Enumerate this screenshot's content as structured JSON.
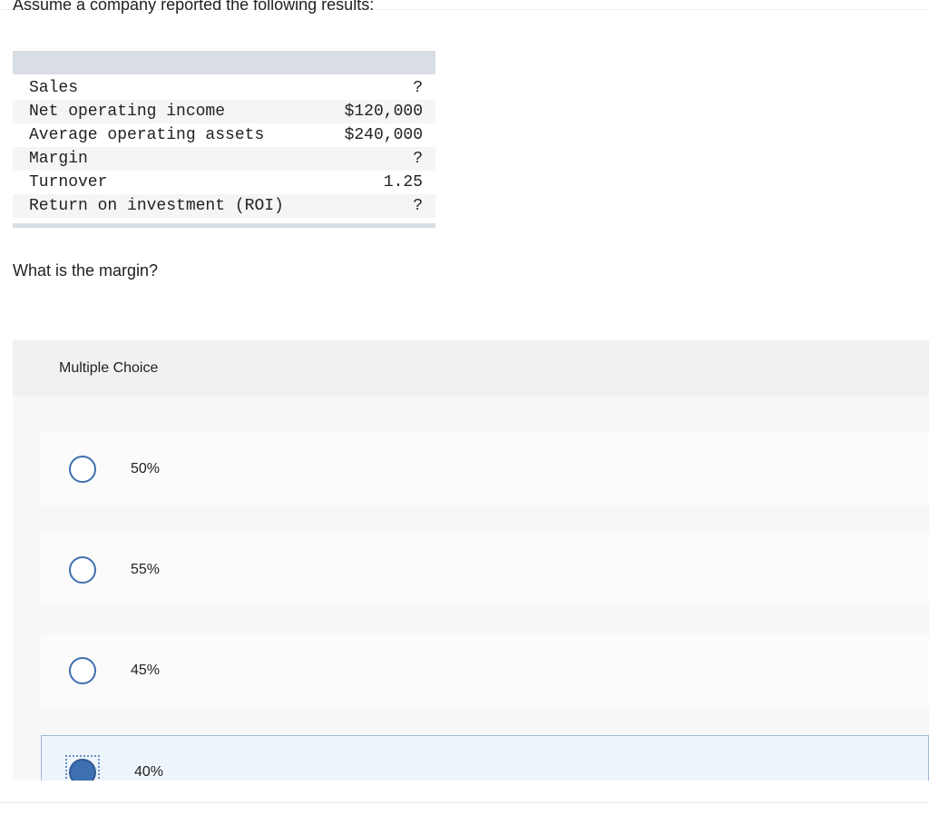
{
  "intro_text": "Assume a company reported the following results:",
  "table": {
    "rows": [
      {
        "label": "Sales",
        "value": "?"
      },
      {
        "label": "Net operating income",
        "value": "$120,000"
      },
      {
        "label": "Average operating assets",
        "value": "$240,000"
      },
      {
        "label": "Margin",
        "value": "?"
      },
      {
        "label": "Turnover",
        "value": "1.25"
      },
      {
        "label": "Return on investment (ROI)",
        "value": "?"
      }
    ]
  },
  "question": "What is the margin?",
  "multiple_choice": {
    "header": "Multiple Choice",
    "selected_index": 3,
    "options": [
      {
        "label": "50%"
      },
      {
        "label": "55%"
      },
      {
        "label": "45%"
      },
      {
        "label": "40%"
      }
    ]
  },
  "colors": {
    "radio_accent": "#3e6fb0",
    "table_bar": "#d9dde4"
  }
}
